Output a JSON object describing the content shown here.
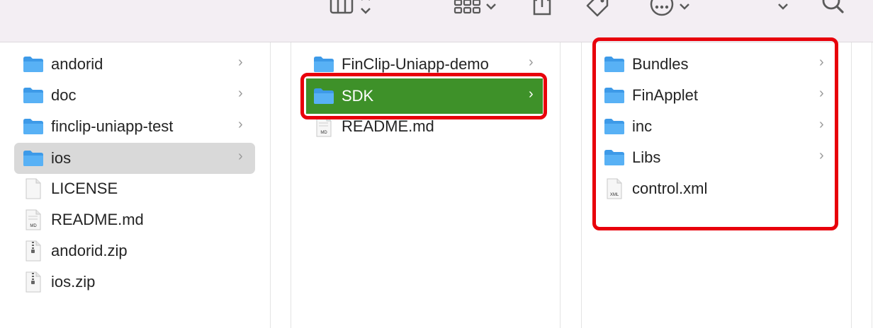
{
  "toolbar": {
    "icons": [
      "column-view-icon",
      "chevron-updown-icon",
      "grid-view-icon",
      "chevron-down-icon",
      "share-icon",
      "tag-icon",
      "more-icon",
      "chevron-down-icon",
      "chevron-down-icon",
      "search-icon"
    ]
  },
  "column1": {
    "items": [
      {
        "label": "andorid",
        "type": "folder"
      },
      {
        "label": "doc",
        "type": "folder"
      },
      {
        "label": "finclip-uniapp-test",
        "type": "folder"
      },
      {
        "label": "ios",
        "type": "folder",
        "selected": true
      },
      {
        "label": "LICENSE",
        "type": "file"
      },
      {
        "label": "README.md",
        "type": "md-file",
        "badge": "MD"
      },
      {
        "label": "andorid.zip",
        "type": "zip-file"
      },
      {
        "label": "ios.zip",
        "type": "zip-file"
      }
    ]
  },
  "column2": {
    "items": [
      {
        "label": "FinClip-Uniapp-demo",
        "type": "folder"
      },
      {
        "label": "SDK",
        "type": "folder",
        "selected": true
      },
      {
        "label": "README.md",
        "type": "md-file",
        "badge": "MD"
      }
    ]
  },
  "column3": {
    "items": [
      {
        "label": "Bundles",
        "type": "folder"
      },
      {
        "label": "FinApplet",
        "type": "folder"
      },
      {
        "label": "inc",
        "type": "folder"
      },
      {
        "label": "Libs",
        "type": "folder"
      },
      {
        "label": "control.xml",
        "type": "xml-file",
        "badge": "XML"
      }
    ]
  },
  "colors": {
    "toolbar_bg": "#f3eef3",
    "selection_green": "#3e9129",
    "selection_gray": "#d9d9d9",
    "highlight_red": "#e8000b",
    "folder_blue": "#3d9ae8"
  }
}
